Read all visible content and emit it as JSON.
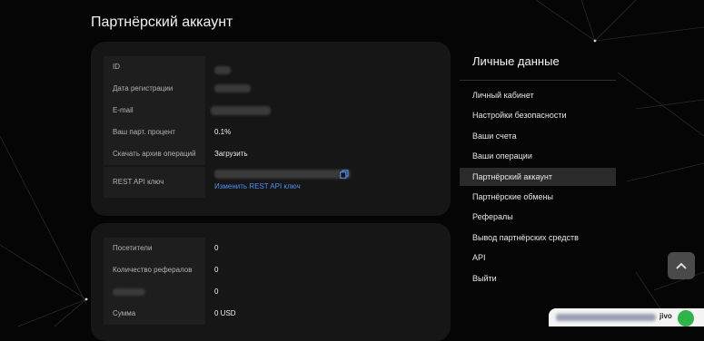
{
  "page": {
    "title": "Партнёрский аккаунт"
  },
  "account": {
    "fields": {
      "id_label": "ID",
      "reg_date_label": "Дата регистрации",
      "email_label": "E-mail",
      "percent_label": "Ваш парт. процент",
      "percent_value": "0.1%",
      "archive_label": "Скачать архив операций",
      "archive_link": "Загрузить",
      "api_label": "REST API ключ",
      "api_change_link": "Изменить REST API ключ"
    }
  },
  "stats": {
    "visitors_label": "Посетители",
    "visitors_value": "0",
    "referrals_label": "Количество рефералов",
    "referrals_value": "0",
    "third_value": "0",
    "sum_label": "Сумма",
    "sum_value": "0 USD"
  },
  "sidebar": {
    "title": "Личные данные",
    "items": [
      {
        "label": "Личный кабинет",
        "active": false
      },
      {
        "label": "Настройки безопасности",
        "active": false
      },
      {
        "label": "Ваши счета",
        "active": false
      },
      {
        "label": "Ваши операции",
        "active": false
      },
      {
        "label": "Партнёрский аккаунт",
        "active": true
      },
      {
        "label": "Партнёрские обмены",
        "active": false
      },
      {
        "label": "Рефералы",
        "active": false
      },
      {
        "label": "Вывод партнёрских средств",
        "active": false
      },
      {
        "label": "API",
        "active": false
      },
      {
        "label": "Выйти",
        "active": false
      }
    ]
  },
  "widgets": {
    "scroll_top_icon": "chevron-up-icon",
    "chat_brand": "jivo",
    "chat_status_color": "#2fb34a"
  },
  "colors": {
    "background": "#050505",
    "card": "#161616",
    "link": "#4f8ff0"
  }
}
